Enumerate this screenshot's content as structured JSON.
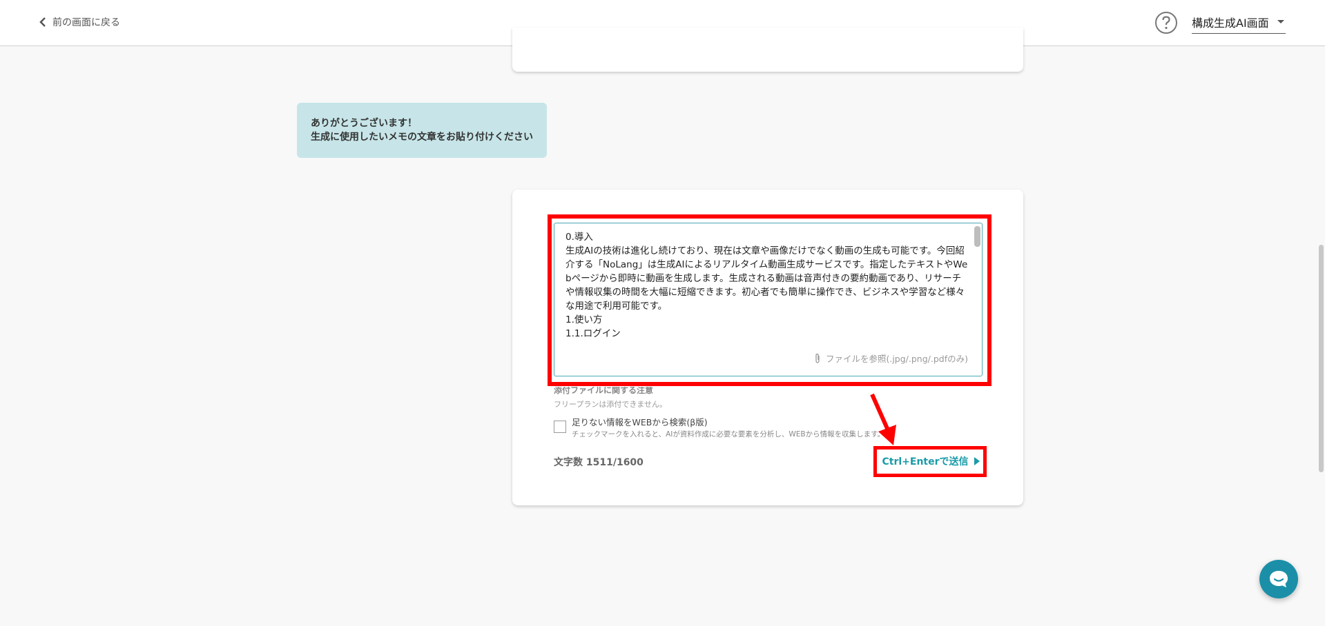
{
  "header": {
    "back_label": "前の画面に戻る",
    "mode_label": "構成生成AI画面"
  },
  "bubble": {
    "line1": "ありがとうございます！",
    "line2": "生成に使用したいメモの文章をお貼り付けください"
  },
  "input": {
    "text": "0.導入\n生成AIの技術は進化し続けており、現在は文章や画像だけでなく動画の生成も可能です。今回紹介する「NoLang」は生成AIによるリアルタイム動画生成サービスです。指定したテキストやWebページから即時に動画を生成します。生成される動画は音声付きの要約動画であり、リサーチや情報収集の時間を大幅に短縮できます。初心者でも簡単に操作でき、ビジネスや学習など様々な用途で利用可能です。\n1.使い方\n1.1.ログイン",
    "attach_label": "ファイルを参照(.jpg/.png/.pdfのみ)"
  },
  "notice": {
    "title": "添付ファイルに関する注意",
    "body": "フリープランは添付できません。"
  },
  "web_search": {
    "label": "足りない情報をWEBから検索(β版)",
    "note": "チェックマークを入れると、AIが資料作成に必要な要素を分析し、WEBから情報を収集します。",
    "checked": false
  },
  "char_count": "文字数 1511/1600",
  "send_label": "Ctrl+Enterで送信",
  "colors": {
    "accent": "#1a9aa8",
    "bubble_bg": "#c7e5e8",
    "highlight": "#ff0000"
  }
}
